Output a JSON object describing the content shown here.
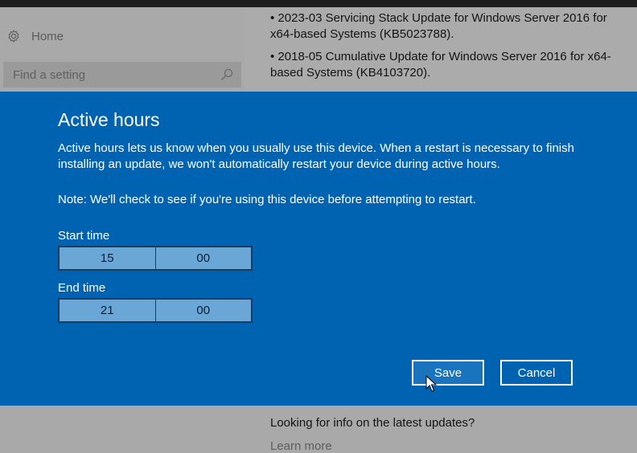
{
  "settings": {
    "home_label": "Home",
    "search_placeholder": "Find a setting"
  },
  "updates": [
    "• 2023-03 Servicing Stack Update for Windows Server 2016 for x64-based Systems (KB5023788).",
    "• 2018-05 Cumulative Update for Windows Server 2016 for x64-based Systems (KB4103720)."
  ],
  "dialog": {
    "title": "Active hours",
    "description": "Active hours lets us know when you usually use this device. When a restart is necessary to finish installing an update, we won't automatically restart your device during active hours.",
    "note": "Note: We'll check to see if you're using this device before attempting to restart.",
    "start_label": "Start time",
    "start_hour": "15",
    "start_minute": "00",
    "end_label": "End time",
    "end_hour": "21",
    "end_minute": "00",
    "save_label": "Save",
    "cancel_label": "Cancel",
    "accent_color": "#0063b1"
  },
  "footer": {
    "info_text": "Looking for info on the latest updates?",
    "learn_more": "Learn more"
  }
}
